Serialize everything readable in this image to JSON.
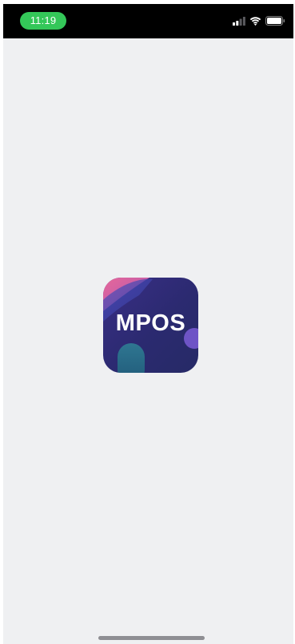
{
  "status_bar": {
    "time": "11:19",
    "signal_icon": "cellular-signal-icon",
    "wifi_icon": "wifi-icon",
    "battery_icon": "battery-icon"
  },
  "splash": {
    "app_name": "MPOS",
    "icon": "mpos-app-icon"
  },
  "colors": {
    "status_bar_bg": "#000000",
    "time_pill": "#34c759",
    "screen_bg": "#eff0f2",
    "icon_bg": "#2a2b6e",
    "home_indicator": "#8e8e93"
  }
}
